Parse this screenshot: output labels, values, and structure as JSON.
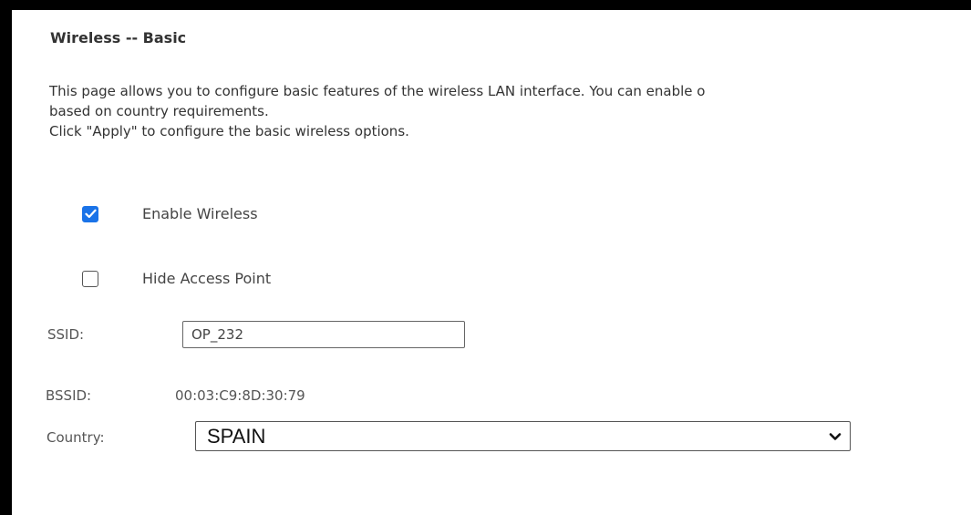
{
  "page": {
    "title": "Wireless -- Basic",
    "description_lines": [
      "This page allows you to configure basic features of the wireless LAN interface. You can enable o",
      "based on country requirements.",
      "Click \"Apply\" to configure the basic wireless options."
    ]
  },
  "options": {
    "enable_wireless": {
      "label": "Enable Wireless",
      "checked": true
    },
    "hide_access_point": {
      "label": "Hide Access Point",
      "checked": false
    }
  },
  "fields": {
    "ssid": {
      "label": "SSID:",
      "value": "OP_232"
    },
    "bssid": {
      "label": "BSSID:",
      "value": "00:03:C9:8D:30:79"
    },
    "country": {
      "label": "Country:",
      "value": "SPAIN"
    }
  },
  "colors": {
    "checkbox_accent": "#1a73e8",
    "frame": "#000000",
    "background": "#ffffff"
  },
  "icons": {
    "check": "checkmark-icon",
    "dropdown": "chevron-down-icon"
  }
}
